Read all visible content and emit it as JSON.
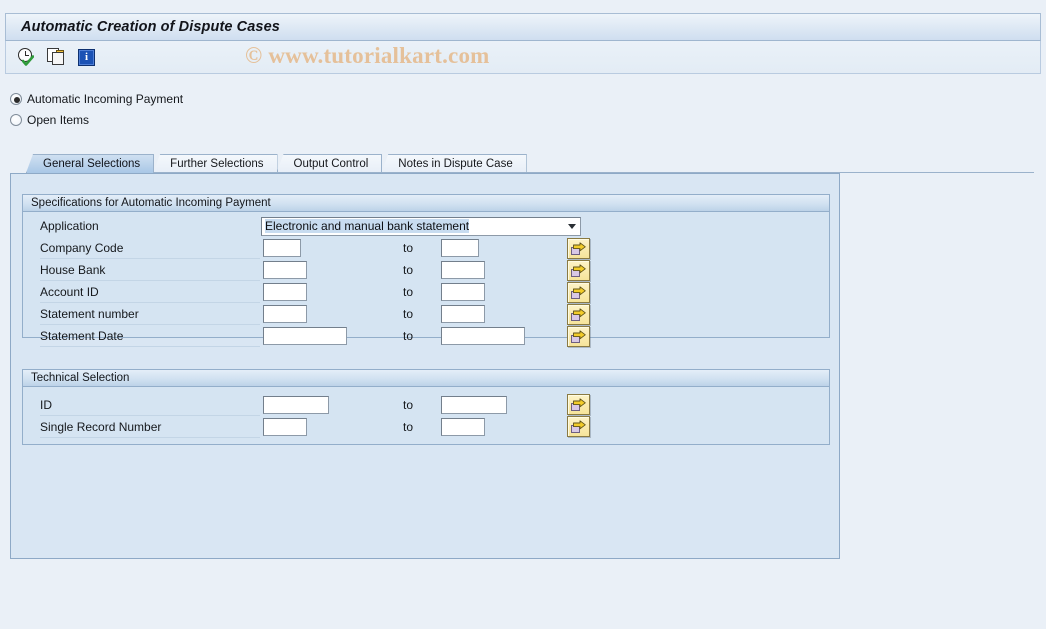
{
  "window": {
    "title": "Automatic Creation of Dispute Cases"
  },
  "watermark": "© www.tutorialkart.com",
  "toolbar": {
    "buttons": [
      {
        "name": "execute-icon",
        "tooltip": "Execute"
      },
      {
        "name": "multiple-selection-icon",
        "tooltip": "Multiple Selection"
      },
      {
        "name": "info-icon",
        "tooltip": "Information",
        "glyph": "i"
      }
    ]
  },
  "mode_selection": {
    "options": [
      {
        "label": "Automatic Incoming Payment",
        "selected": true
      },
      {
        "label": "Open Items",
        "selected": false
      }
    ]
  },
  "tabs": [
    {
      "label": "General Selections",
      "active": true
    },
    {
      "label": "Further Selections",
      "active": false
    },
    {
      "label": "Output Control",
      "active": false
    },
    {
      "label": "Notes in Dispute Case",
      "active": false
    }
  ],
  "groups": [
    {
      "title": "Specifications for Automatic Incoming Payment",
      "dropdown": {
        "label": "Application",
        "value": "Electronic and manual bank statement"
      },
      "rows": [
        {
          "label": "Company Code",
          "from": "",
          "to_label": "to",
          "to": "",
          "from_width": 38,
          "to_width": 38,
          "has_multi": true
        },
        {
          "label": "House Bank",
          "from": "",
          "to_label": "to",
          "to": "",
          "from_width": 44,
          "to_width": 44,
          "has_multi": true
        },
        {
          "label": "Account ID",
          "from": "",
          "to_label": "to",
          "to": "",
          "from_width": 44,
          "to_width": 44,
          "has_multi": true
        },
        {
          "label": "Statement number",
          "from": "",
          "to_label": "to",
          "to": "",
          "from_width": 44,
          "to_width": 44,
          "has_multi": true
        },
        {
          "label": "Statement Date",
          "from": "",
          "to_label": "to",
          "to": "",
          "from_width": 84,
          "to_width": 84,
          "has_multi": true
        }
      ]
    },
    {
      "title": "Technical Selection",
      "rows": [
        {
          "label": "ID",
          "from": "",
          "to_label": "to",
          "to": "",
          "from_width": 66,
          "to_width": 66,
          "has_multi": true
        },
        {
          "label": "Single Record Number",
          "from": "",
          "to_label": "to",
          "to": "",
          "from_width": 44,
          "to_width": 44,
          "has_multi": true
        }
      ]
    }
  ],
  "colors": {
    "page_background": "#eaf0f7",
    "panel_background": "#d9e6f3",
    "group_background": "#d5e4f2",
    "border": "#8ea9c6",
    "active_tab": "#a9c7e6",
    "watermark": "#e5b98a",
    "button_yellow": "#f6e49a",
    "info_blue": "#1b52b5"
  }
}
